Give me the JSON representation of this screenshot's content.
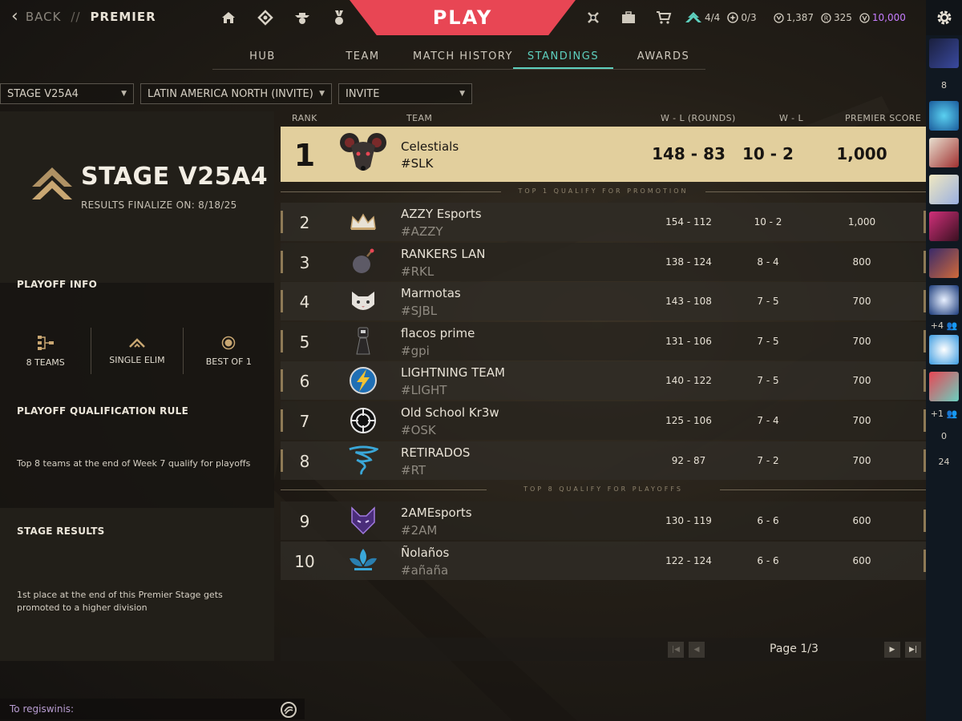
{
  "topbar": {
    "back_label": "BACK",
    "separator": "//",
    "current_page": "PREMIER",
    "play_label": "PLAY",
    "premier_progress": "4/4",
    "mission_progress": "0/3",
    "currency_kingdom": "1,387",
    "currency_radianite": "325",
    "currency_vp": "10,000"
  },
  "tabs": [
    {
      "label": "HUB",
      "active": false
    },
    {
      "label": "TEAM",
      "active": false
    },
    {
      "label": "MATCH HISTORY",
      "active": false
    },
    {
      "label": "STANDINGS",
      "active": true
    },
    {
      "label": "AWARDS",
      "active": false
    }
  ],
  "filters": {
    "stage": "STAGE V25A4",
    "region": "LATIN AMERICA NORTH (INVITE)",
    "division": "INVITE"
  },
  "stage": {
    "title": "STAGE V25A4",
    "finalize": "RESULTS FINALIZE ON: 8/18/25"
  },
  "playoff_info": {
    "heading": "PLAYOFF INFO",
    "teams": "8 TEAMS",
    "format": "SINGLE ELIM",
    "bestof": "BEST OF 1"
  },
  "qualification": {
    "heading": "PLAYOFF QUALIFICATION RULE",
    "text": "Top 8 teams at the end of Week 7 qualify for playoffs"
  },
  "stage_results": {
    "heading": "STAGE RESULTS",
    "text": "1st place at the end of this Premier Stage gets promoted to a higher division"
  },
  "table": {
    "headers": {
      "rank": "RANK",
      "team": "TEAM",
      "wl_rounds": "W - L (ROUNDS)",
      "wl": "W - L",
      "score": "PREMIER SCORE"
    },
    "promotion_line": "TOP 1 QUALIFY FOR PROMOTION",
    "playoff_line": "TOP 8 QUALIFY FOR PLAYOFFS",
    "rows": [
      {
        "rank": "1",
        "name": "Celestials",
        "tag": "#SLK",
        "rounds": "148 - 83",
        "wl": "10 - 2",
        "score": "1,000"
      },
      {
        "rank": "2",
        "name": "AZZY Esports",
        "tag": "#AZZY",
        "rounds": "154 - 112",
        "wl": "10 - 2",
        "score": "1,000"
      },
      {
        "rank": "3",
        "name": "RANKERS LAN",
        "tag": "#RKL",
        "rounds": "138 - 124",
        "wl": "8 - 4",
        "score": "800"
      },
      {
        "rank": "4",
        "name": "Marmotas",
        "tag": "#SJBL",
        "rounds": "143 - 108",
        "wl": "7 - 5",
        "score": "700"
      },
      {
        "rank": "5",
        "name": "flacos prime",
        "tag": "#gpi",
        "rounds": "131 - 106",
        "wl": "7 - 5",
        "score": "700"
      },
      {
        "rank": "6",
        "name": "LIGHTNING TEAM",
        "tag": "#LIGHT",
        "rounds": "140 - 122",
        "wl": "7 - 5",
        "score": "700"
      },
      {
        "rank": "7",
        "name": "Old School Kr3w",
        "tag": "#OSK",
        "rounds": "125 - 106",
        "wl": "7 - 4",
        "score": "700"
      },
      {
        "rank": "8",
        "name": "RETIRADOS",
        "tag": "#RT",
        "rounds": "92 - 87",
        "wl": "7 - 2",
        "score": "700"
      },
      {
        "rank": "9",
        "name": "2AMEsports",
        "tag": "#2AM",
        "rounds": "130 - 119",
        "wl": "6 - 6",
        "score": "600"
      },
      {
        "rank": "10",
        "name": "Ñolaños",
        "tag": "#añaña",
        "rounds": "122 - 124",
        "wl": "6 - 6",
        "score": "600"
      }
    ]
  },
  "pager": {
    "text": "Page 1/3"
  },
  "chat": {
    "to": "To regiswinis:"
  },
  "social": {
    "count_top": "8",
    "party_extra_1": "+4",
    "party_extra_2": "+1",
    "count_a": "0",
    "count_b": "24"
  },
  "colors": {
    "accent": "#5ed0be",
    "play": "#e84654",
    "highlight": "#e2cf9d",
    "vp": "#c77dff"
  }
}
